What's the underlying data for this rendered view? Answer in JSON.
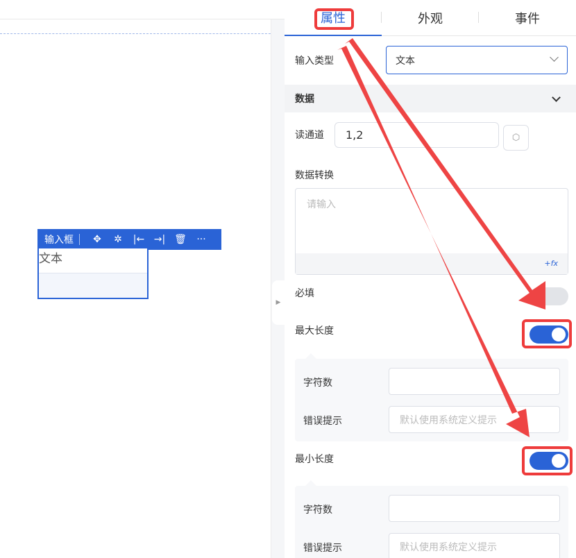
{
  "canvas": {
    "widget_toolbar": {
      "label": "输入框",
      "icons": [
        "move-icon",
        "bug-icon",
        "align-left-icon",
        "align-right-icon",
        "delete-icon",
        "more-icon"
      ],
      "glyphs": [
        "✥",
        "✲",
        "|←",
        "→|",
        "🗑",
        "···"
      ]
    },
    "widget_text": "文本"
  },
  "tabs": [
    {
      "label": "属性",
      "active": true
    },
    {
      "label": "外观",
      "active": false
    },
    {
      "label": "事件",
      "active": false
    }
  ],
  "props": {
    "input_type_label": "输入类型",
    "input_type_value": "文本",
    "section_data": "数据",
    "read_channel_label": "读通道",
    "read_channel_value": "1,2",
    "transform_label": "数据转换",
    "transform_placeholder": "请输入",
    "fx_label": "+fx",
    "required_label": "必填",
    "required_on": false,
    "max_length_label": "最大长度",
    "max_length_on": true,
    "max_chars_label": "字符数",
    "max_chars_value": "",
    "max_error_label": "错误提示",
    "max_error_placeholder": "默认使用系统定义提示",
    "min_length_label": "最小长度",
    "min_length_on": true,
    "min_chars_label": "字符数",
    "min_chars_value": "",
    "min_error_label": "错误提示",
    "min_error_placeholder": "默认使用系统定义提示"
  },
  "colors": {
    "accent": "#2a63d6",
    "annotation": "#ee3b3b"
  }
}
